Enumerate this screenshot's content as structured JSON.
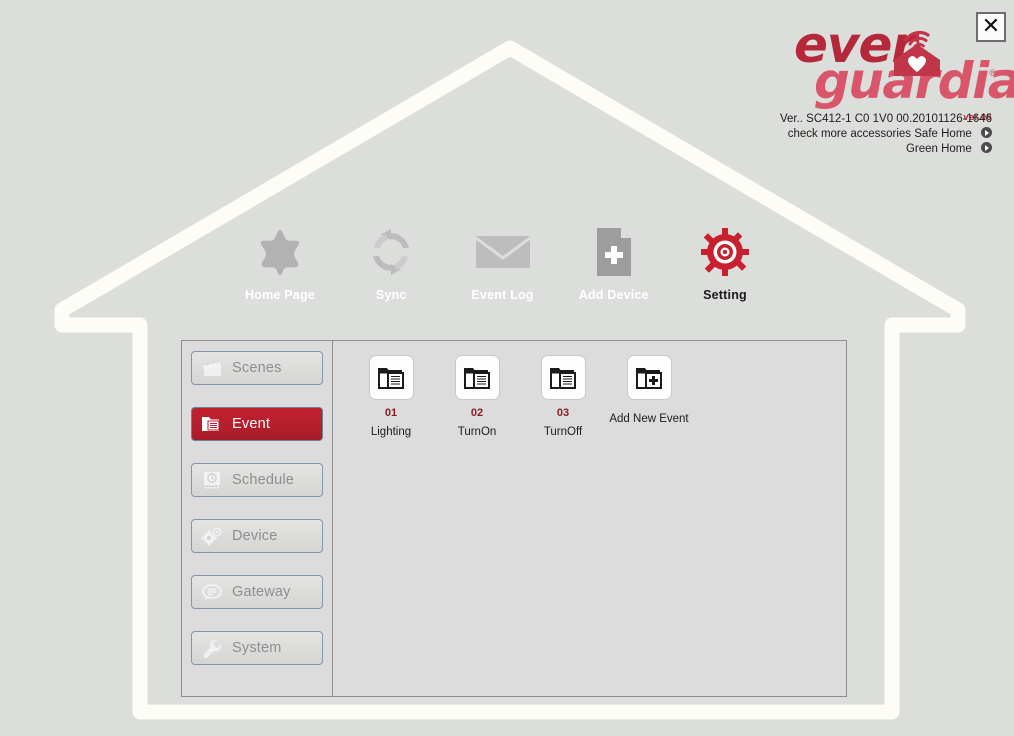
{
  "window": {
    "close_label": "✕",
    "close_icon": "close-icon"
  },
  "brand": {
    "name_part1": "ever",
    "name_part2": "guardian",
    "registered": "®",
    "version_tag": "ver.05",
    "logo_icon": "house-wifi-heart-icon"
  },
  "meta": {
    "version_line": "Ver.. SC412-1  C0  1V0  00.20101126-1646",
    "accessories_text": "check more accessories",
    "safe_home": "Safe Home",
    "green_home": "Green Home"
  },
  "topnav": {
    "items": [
      {
        "label": "Home Page",
        "icon": "star-icon",
        "active": false
      },
      {
        "label": "Sync",
        "icon": "sync-refresh-icon",
        "active": false
      },
      {
        "label": "Event Log",
        "icon": "envelope-icon",
        "active": false
      },
      {
        "label": "Add Device",
        "icon": "document-plus-icon",
        "active": false
      },
      {
        "label": "Setting",
        "icon": "gear-icon",
        "active": true
      }
    ]
  },
  "sidebar": {
    "items": [
      {
        "label": "Scenes",
        "icon": "clapperboard-icon",
        "active": false
      },
      {
        "label": "Event",
        "icon": "folder-lines-icon",
        "active": true
      },
      {
        "label": "Schedule",
        "icon": "alarm-clock-icon",
        "active": false
      },
      {
        "label": "Device",
        "icon": "gears-icon",
        "active": false
      },
      {
        "label": "Gateway",
        "icon": "speech-bubble-icon",
        "active": false
      },
      {
        "label": "System",
        "icon": "wrench-icon",
        "active": false
      }
    ]
  },
  "content": {
    "tiles": [
      {
        "number": "01",
        "label": "Lighting",
        "icon": "folder-lines-icon",
        "add": false
      },
      {
        "number": "02",
        "label": "TurnOn",
        "icon": "folder-lines-icon",
        "add": false
      },
      {
        "number": "03",
        "label": "TurnOff",
        "icon": "folder-lines-icon",
        "add": false
      },
      {
        "number": "",
        "label": "Add New Event",
        "icon": "folder-plus-icon",
        "add": true
      }
    ]
  },
  "colors": {
    "background": "#dcdedb",
    "panel": "#dcdcdc",
    "accent_red": "#b5283a",
    "accent_red_light": "#d9566a",
    "active_button": "#bb1f2d",
    "house_outline": "#fdfcf7"
  }
}
